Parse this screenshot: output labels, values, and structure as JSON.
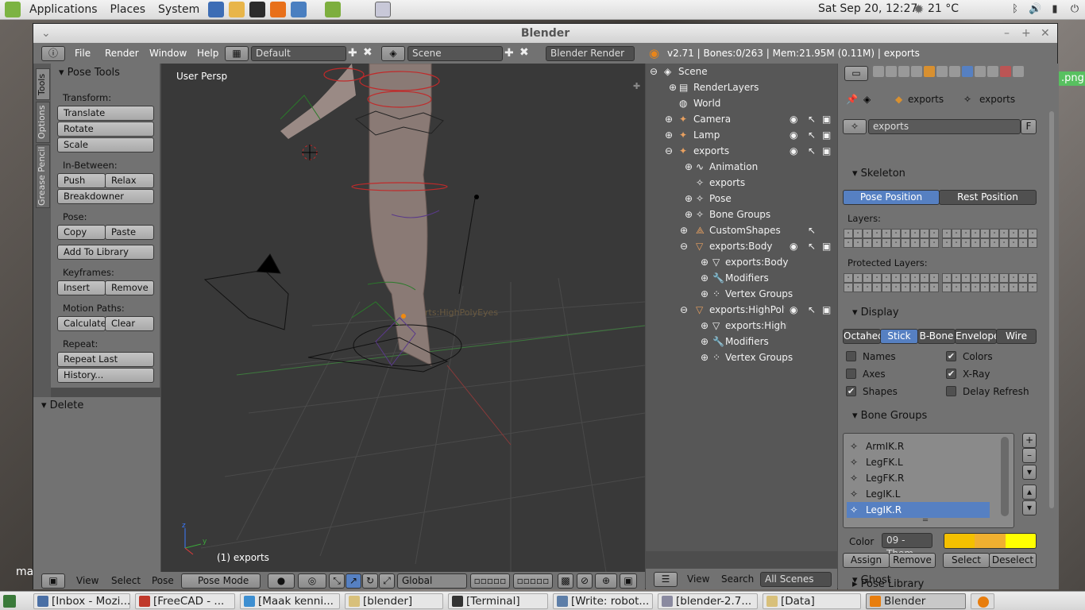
{
  "top_panel": {
    "menus": [
      "Applications",
      "Places",
      "System"
    ],
    "clock": "Sat Sep 20, 12:27",
    "weather": "21 °C"
  },
  "window": {
    "title": "Blender"
  },
  "info_header": {
    "menus": [
      "File",
      "Render",
      "Window",
      "Help"
    ],
    "screen_layout": "Default",
    "scene": "Scene",
    "render_engine": "Blender Render",
    "stats": "v2.71 | Bones:0/263  | Mem:21.95M (0.11M) | exports"
  },
  "tool_tabs": [
    "Tools",
    "Options",
    "Grease Pencil"
  ],
  "pose_tools": {
    "title": "Pose Tools",
    "transform_label": "Transform:",
    "translate": "Translate",
    "rotate": "Rotate",
    "scale": "Scale",
    "inbetween_label": "In-Between:",
    "push": "Push",
    "relax": "Relax",
    "breakdowner": "Breakdowner",
    "pose_label": "Pose:",
    "copy": "Copy",
    "paste": "Paste",
    "add_to_library": "Add To Library",
    "keyframes_label": "Keyframes:",
    "insert": "Insert",
    "remove": "Remove",
    "motion_paths_label": "Motion Paths:",
    "calculate": "Calculate",
    "clear": "Clear",
    "repeat_label": "Repeat:",
    "repeat_last": "Repeat Last",
    "history": "History..."
  },
  "delete_panel": {
    "title": "Delete"
  },
  "viewport": {
    "view_name": "User Persp",
    "object_label": "(1) exports",
    "armature_name_overlay": "rts:HighPolyEyes"
  },
  "viewport_header": {
    "menus": [
      "View",
      "Select",
      "Pose"
    ],
    "mode": "Pose Mode",
    "orientation": "Global"
  },
  "outliner": {
    "rows": [
      {
        "label": "Scene"
      },
      {
        "label": "RenderLayers"
      },
      {
        "label": "World"
      },
      {
        "label": "Camera"
      },
      {
        "label": "Lamp"
      },
      {
        "label": "exports"
      },
      {
        "label": "Animation"
      },
      {
        "label": "exports"
      },
      {
        "label": "Pose"
      },
      {
        "label": "Bone Groups"
      },
      {
        "label": "CustomShapes"
      },
      {
        "label": "exports:Body"
      },
      {
        "label": "exports:Body"
      },
      {
        "label": "Modifiers"
      },
      {
        "label": "Vertex Groups"
      },
      {
        "label": "exports:HighPolyEye"
      },
      {
        "label": "exports:HighPol"
      },
      {
        "label": "Modifiers"
      },
      {
        "label": "Vertex Groups"
      }
    ]
  },
  "outliner_header": {
    "view": "View",
    "search": "Search",
    "filter": "All Scenes"
  },
  "properties": {
    "breadcrumb_object": "exports",
    "breadcrumb_data": "exports",
    "datablock_name": "exports",
    "datablock_fake_user": "F",
    "skeleton": {
      "title": "Skeleton",
      "pose_position": "Pose Position",
      "rest_position": "Rest Position",
      "layers_label": "Layers:",
      "protected_layers_label": "Protected Layers:"
    },
    "display": {
      "title": "Display",
      "types": [
        "Octahed",
        "Stick",
        "B-Bone",
        "Envelope",
        "Wire"
      ],
      "selected_type": "Stick",
      "names": "Names",
      "colors": "Colors",
      "axes": "Axes",
      "xray": "X-Ray",
      "shapes": "Shapes",
      "delay_refresh": "Delay Refresh"
    },
    "bone_groups": {
      "title": "Bone Groups",
      "items": [
        "ArmIK.R",
        "LegFK.L",
        "LegFK.R",
        "LegIK.L",
        "LegIK.R"
      ],
      "selected": "LegIK.R",
      "color_label": "Color",
      "color_theme": "09 - Them",
      "swatches": [
        "#f4c000",
        "#f0b030",
        "#ffff00"
      ],
      "assign": "Assign",
      "remove": "Remove",
      "select": "Select",
      "deselect": "Deselect"
    },
    "pose_library": {
      "title": "Pose Library"
    },
    "ghost": {
      "title": "Ghost"
    }
  },
  "desktop": {
    "png_label": ".png",
    "edge_text": "ma"
  },
  "taskbar": {
    "items": [
      {
        "label": "[Inbox - Mozi...",
        "icon_color": "#4a6fa5"
      },
      {
        "label": "[FreeCAD - ...",
        "icon_color": "#c0392b"
      },
      {
        "label": "[Maak kenni...",
        "icon_color": "#3d8fd1"
      },
      {
        "label": "[blender]",
        "icon_color": "#d8c07a"
      },
      {
        "label": "[Terminal]",
        "icon_color": "#333333"
      },
      {
        "label": "[Write: robot...",
        "icon_color": "#5d7ea8"
      },
      {
        "label": "[blender-2.7...",
        "icon_color": "#8a8aa0"
      },
      {
        "label": "[Data]",
        "icon_color": "#d8c07a"
      },
      {
        "label": "Blender",
        "icon_color": "#e87d0d"
      }
    ]
  }
}
